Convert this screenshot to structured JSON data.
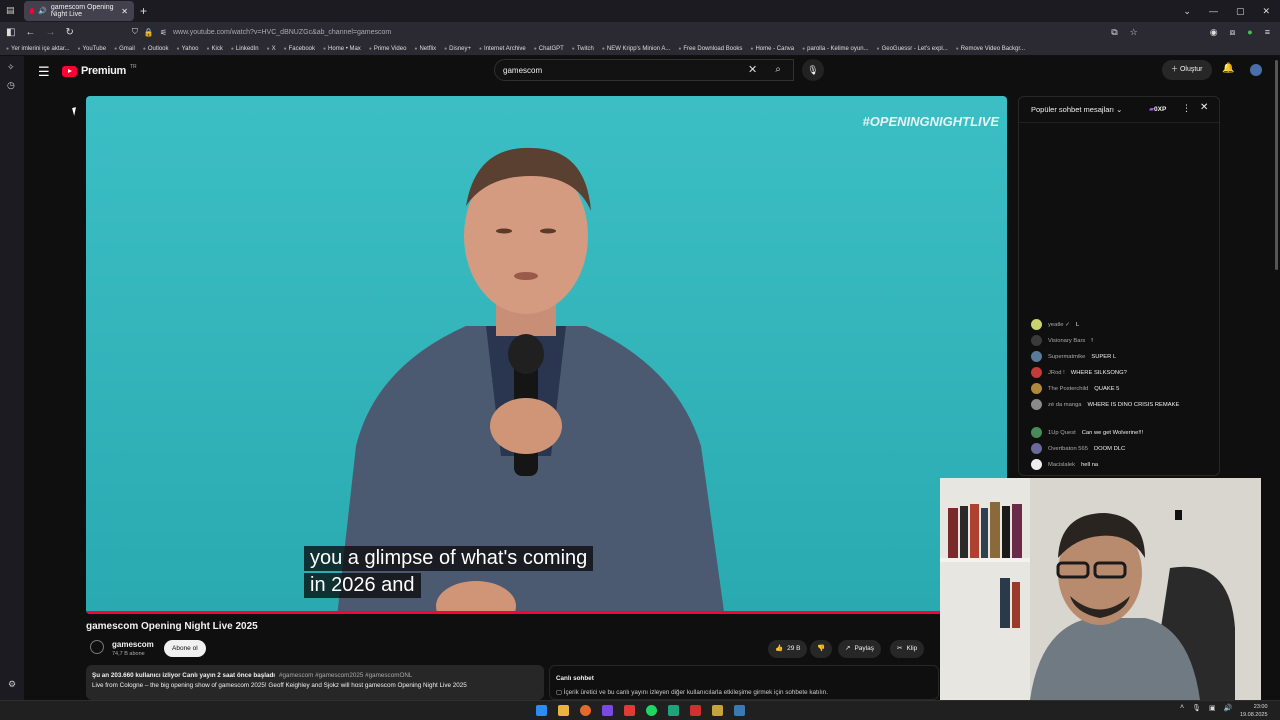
{
  "browser": {
    "tab_title": "gamescom Opening Night Live",
    "url": "www.youtube.com/watch?v=HVC_dBNUZGc&ab_channel=gamescom",
    "bookmarks": [
      "Yer imlerini içe aktar...",
      "YouTube",
      "Gmail",
      "Outlook",
      "Yahoo",
      "Kick",
      "LinkedIn",
      "X",
      "Facebook",
      "Home • Max",
      "Prime Video",
      "Netflix",
      "Disney+",
      "Internet Archive",
      "ChatGPT",
      "Twitch",
      "NEW Kripp's Minion A...",
      "Free Download Books",
      "Home - Canva",
      "parolla - Kelime oyun...",
      "GeoGuessr - Let's expl...",
      "Remove Video Backgr..."
    ]
  },
  "youtube": {
    "logo_text": "Premium",
    "logo_region": "TR",
    "search_value": "gamescom",
    "create_label": "Oluştur"
  },
  "video": {
    "overlay_hashtag": "#OPENINGNIGHTLIVE",
    "caption_line1": "you a glimpse of what's coming",
    "caption_line2": "in 2026 and",
    "progress_fraction": 0.93,
    "title": "gamescom Opening Night Live 2025",
    "channel_name": "gamescom",
    "subscribers": "74,7 B abone",
    "subscribe_label": "Abone ol",
    "likes": "29 B",
    "share_label": "Paylaş",
    "clip_label": "Klip"
  },
  "description": {
    "meta": "Şu an 203.660 kullanıcı izliyor  Canlı yayın 2 saat önce başladı",
    "tags": "#gamescom #gamescom2025 #gamescomONL",
    "text": "Live from Cologne – the big opening show of gamescom 2025! Geoff Keighley and Sjokz will host gamescom Opening Night Live 2025"
  },
  "livechat_box": {
    "title": "Canlı sohbet",
    "notice": "İçerik üretici ve bu canlı yayını izleyen diğer kullanıcılarla etkileşime girmek için sohbete katılın."
  },
  "chat": {
    "title": "Popüler sohbet mesajları",
    "xp": "0XP",
    "messages": [
      {
        "author": "yeatle ✓",
        "text": "L",
        "color": "#c9d36b"
      },
      {
        "author": "Visionary Bars",
        "text": "!",
        "color": "#3a3a3a"
      },
      {
        "author": "Supermatmike",
        "text": "SUPER L",
        "color": "#5a7a9a"
      },
      {
        "author": "JRod !",
        "text": "WHERE SILKSONG?",
        "color": "#c43a3a"
      },
      {
        "author": "The Posterchild",
        "text": "QUAKE 5",
        "color": "#b08a3a"
      },
      {
        "author": "zé da manga",
        "text": "WHERE IS DINO CRISIS REMAKE",
        "color": "#8a8a8a"
      },
      {
        "author": "1Up Quest",
        "text": "Can we get Wolverine!!!",
        "color": "#4a8a5a"
      },
      {
        "author": "Overtbaton 565",
        "text": "DOOM DLC",
        "color": "#6a6a9a"
      },
      {
        "author": "Macislalek",
        "text": "hell na",
        "color": "#eeeeee"
      }
    ]
  },
  "taskbar": {
    "time": "23:00",
    "date": "19.08.2025"
  }
}
